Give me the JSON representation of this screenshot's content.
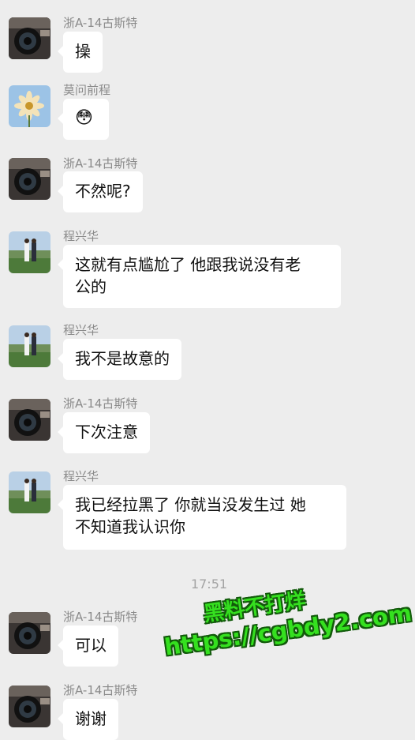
{
  "messages": [
    {
      "sender": "浙A-14古斯特",
      "text": "操",
      "avatar": "camera"
    },
    {
      "sender": "莫问前程",
      "text": "😳",
      "avatar": "flower"
    },
    {
      "sender": "浙A-14古斯特",
      "text": "不然呢?",
      "avatar": "camera"
    },
    {
      "sender": "程兴华",
      "text_line1": "这就有点尴尬了 他跟我说没有老",
      "text_line2": "公的",
      "avatar": "couple"
    },
    {
      "sender": "程兴华",
      "text": "我不是故意的",
      "avatar": "couple"
    },
    {
      "sender": "浙A-14古斯特",
      "text": "下次注意",
      "avatar": "camera"
    },
    {
      "sender": "程兴华",
      "text_line1": "我已经拉黑了 你就当没发生过 她",
      "text_line2": "不知道我认识你",
      "avatar": "couple"
    },
    {
      "sender": "浙A-14古斯特",
      "text": "可以",
      "avatar": "camera"
    },
    {
      "sender": "浙A-14古斯特",
      "text": "谢谢",
      "avatar": "camera"
    }
  ],
  "timestamp": "17:51",
  "watermark": {
    "line1": "黑料不打烊",
    "line2": "https://cgbdy2.com"
  },
  "colors": {
    "background": "#ededed",
    "bubble": "#ffffff",
    "watermark": "#35e01f"
  }
}
